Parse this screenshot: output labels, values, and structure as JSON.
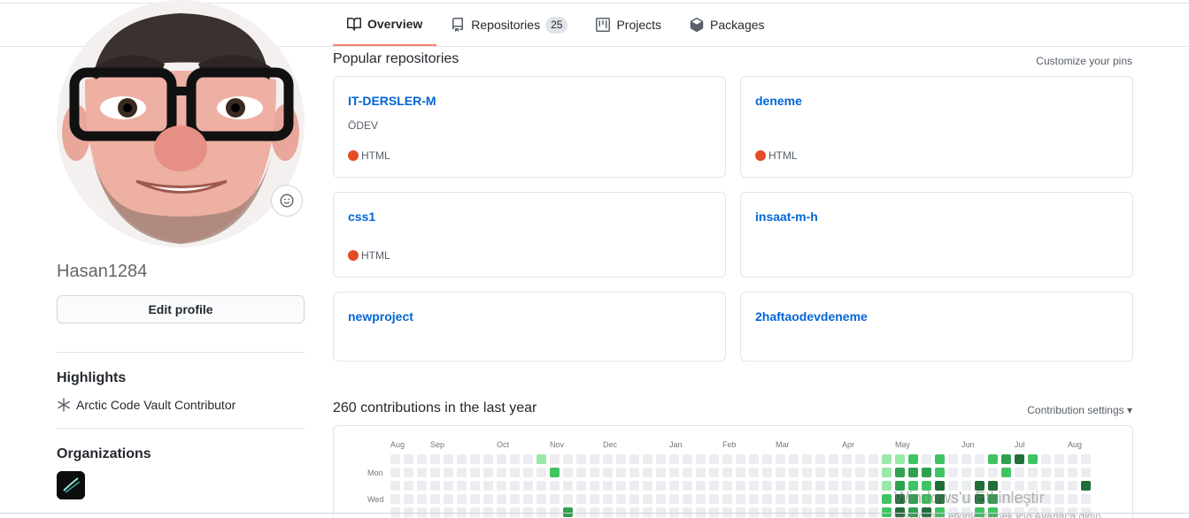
{
  "tabs": [
    {
      "label": "Overview",
      "icon": "book-icon",
      "active": true
    },
    {
      "label": "Repositories",
      "icon": "repo-icon",
      "count": "25"
    },
    {
      "label": "Projects",
      "icon": "project-icon"
    },
    {
      "label": "Packages",
      "icon": "package-icon"
    }
  ],
  "profile": {
    "username": "Hasan1284",
    "edit_label": "Edit profile"
  },
  "highlights": {
    "title": "Highlights",
    "item": "Arctic Code Vault Contributor"
  },
  "organizations": {
    "title": "Organizations"
  },
  "popular": {
    "title": "Popular repositories",
    "customize": "Customize your pins",
    "repos": [
      {
        "name": "IT-DERSLER-M",
        "description": "ÖDEV",
        "language": "HTML",
        "lang_color": "#e34c26"
      },
      {
        "name": "deneme",
        "description": "",
        "language": "HTML",
        "lang_color": "#e34c26"
      },
      {
        "name": "css1",
        "description": "",
        "language": "HTML",
        "lang_color": "#e34c26"
      },
      {
        "name": "insaat-m-h",
        "description": "",
        "language": "",
        "lang_color": ""
      },
      {
        "name": "newproject",
        "description": "",
        "language": "",
        "lang_color": ""
      },
      {
        "name": "2haftaodevdeneme",
        "description": "",
        "language": "",
        "lang_color": ""
      }
    ]
  },
  "contributions": {
    "title": "260 contributions in the last year",
    "settings": "Contribution settings ▾",
    "months": [
      "Aug",
      "Sep",
      "Oct",
      "Nov",
      "Dec",
      "Jan",
      "Feb",
      "Mar",
      "Apr",
      "May",
      "Jun",
      "Jul",
      "Aug"
    ],
    "day_labels": [
      "Mon",
      "Wed"
    ],
    "colors": [
      "#ebedf0",
      "#9be9a8",
      "#40c463",
      "#30a14e",
      "#216e39"
    ],
    "grid": [
      [
        0,
        0,
        0,
        0,
        0,
        0,
        0,
        0,
        0,
        0,
        0,
        1,
        0,
        0,
        0,
        0,
        0,
        0,
        0,
        0,
        0,
        0,
        0,
        0,
        0,
        0,
        0,
        0,
        0,
        0,
        0,
        0,
        0,
        0,
        0,
        0,
        0,
        1,
        1,
        2,
        0,
        2,
        0,
        0,
        0,
        2,
        3,
        4,
        2,
        0,
        0,
        0,
        0
      ],
      [
        0,
        0,
        0,
        0,
        0,
        0,
        0,
        0,
        0,
        0,
        0,
        0,
        2,
        0,
        0,
        0,
        0,
        0,
        0,
        0,
        0,
        0,
        0,
        0,
        0,
        0,
        0,
        0,
        0,
        0,
        0,
        0,
        0,
        0,
        0,
        0,
        0,
        1,
        3,
        3,
        3,
        2,
        0,
        0,
        0,
        0,
        2,
        0,
        0,
        0,
        0,
        0,
        0
      ],
      [
        0,
        0,
        0,
        0,
        0,
        0,
        0,
        0,
        0,
        0,
        0,
        0,
        0,
        0,
        0,
        0,
        0,
        0,
        0,
        0,
        0,
        0,
        0,
        0,
        0,
        0,
        0,
        0,
        0,
        0,
        0,
        0,
        0,
        0,
        0,
        0,
        0,
        1,
        3,
        2,
        2,
        4,
        0,
        0,
        4,
        4,
        0,
        0,
        0,
        0,
        0,
        0,
        4
      ],
      [
        0,
        0,
        0,
        0,
        0,
        0,
        0,
        0,
        0,
        0,
        0,
        0,
        0,
        0,
        0,
        0,
        0,
        0,
        0,
        0,
        0,
        0,
        0,
        0,
        0,
        0,
        0,
        0,
        0,
        0,
        0,
        0,
        0,
        0,
        0,
        0,
        0,
        2,
        4,
        3,
        2,
        4,
        0,
        0,
        4,
        3,
        0,
        0,
        0,
        0,
        0,
        0,
        0
      ],
      [
        0,
        0,
        0,
        0,
        0,
        0,
        0,
        0,
        0,
        0,
        0,
        0,
        0,
        3,
        0,
        0,
        0,
        0,
        0,
        0,
        0,
        0,
        0,
        0,
        0,
        0,
        0,
        0,
        0,
        0,
        0,
        0,
        0,
        0,
        0,
        0,
        0,
        2,
        4,
        3,
        4,
        2,
        0,
        0,
        2,
        2,
        0,
        0,
        0,
        0,
        0,
        0,
        0
      ]
    ]
  },
  "watermark": {
    "line1": "Windows'u Etkinleştir",
    "line2": "Windows'u etkinleştirmek için Ayarlar'a gidin."
  }
}
